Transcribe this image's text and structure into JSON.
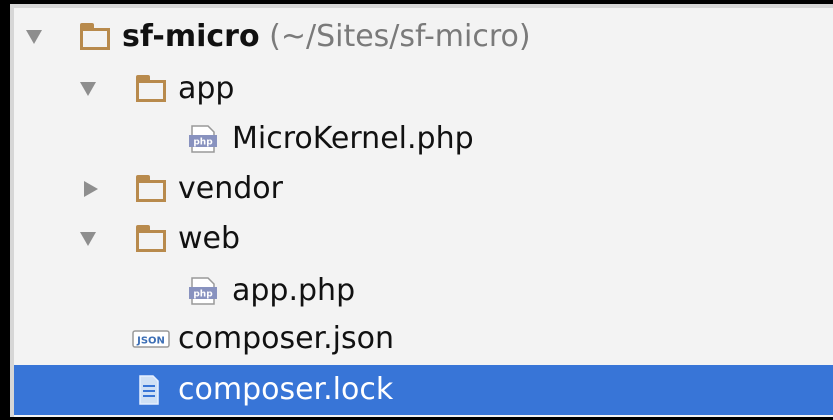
{
  "tree": {
    "root": {
      "label": "sf-micro",
      "path": "(~/Sites/sf-micro)"
    },
    "items": [
      {
        "label": "app"
      },
      {
        "label": "MicroKernel.php"
      },
      {
        "label": "vendor"
      },
      {
        "label": "web"
      },
      {
        "label": "app.php"
      },
      {
        "label": "composer.json"
      },
      {
        "label": "composer.lock"
      }
    ]
  },
  "icons": {
    "folder": "folder-icon",
    "php": "php-file-icon",
    "json": "json-file-icon",
    "text": "text-file-icon"
  },
  "colors": {
    "selection": "#3875d7",
    "folder": "#b88a4c",
    "php_badge": "#8892bf"
  }
}
